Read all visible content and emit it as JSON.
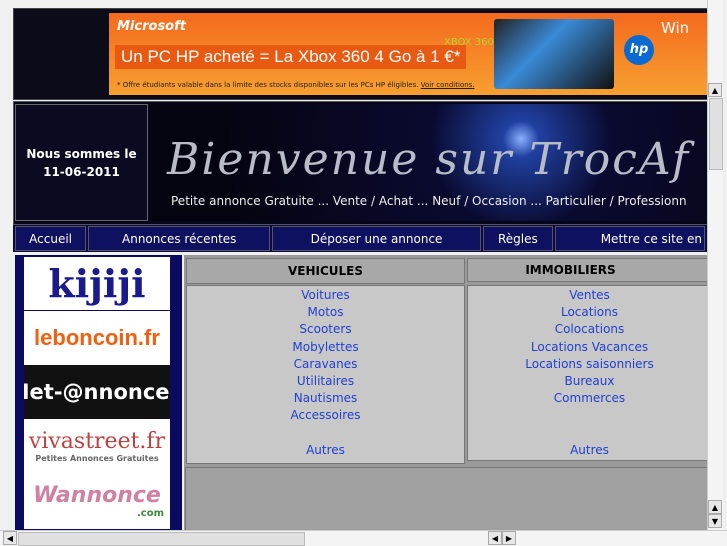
{
  "ad": {
    "brand": "Microsoft",
    "headline": "Un PC HP acheté = La Xbox 360 4 Go à 1 €*",
    "fine_print": "* Offre étudiants valable dans la limite des stocks disponibles sur les PCs HP éligibles.",
    "link": "Voir conditions.",
    "xbox": "XBOX 360",
    "hp": "hp",
    "windows": "Win"
  },
  "header": {
    "date_label": "Nous sommes le",
    "date": "11-06-2011",
    "welcome": "Bienvenue sur TrocAf",
    "tagline": "Petite annonce Gratuite ... Vente / Achat ... Neuf / Occasion ... Particulier / Professionn"
  },
  "nav": [
    {
      "label": "Accueil"
    },
    {
      "label": "Annonces récentes"
    },
    {
      "label": "Déposer une annonce"
    },
    {
      "label": "Règles"
    },
    {
      "label": "Mettre ce site en"
    }
  ],
  "logos": [
    {
      "label": "kijiji"
    },
    {
      "label": "leboncoin.fr"
    },
    {
      "label": "Net-@nnonces"
    },
    {
      "label": "vivastreet.fr",
      "sub": "Petites Annonces Gratuites"
    },
    {
      "label": "Wannonce",
      "sub": ".com"
    }
  ],
  "categories": [
    {
      "title": "VEHICULES",
      "items": [
        "Voitures",
        "Motos",
        "Scooters",
        "Mobylettes",
        "Caravanes",
        "Utilitaires",
        "Nautismes",
        "Accessoires"
      ],
      "other": "Autres"
    },
    {
      "title": "IMMOBILIERS",
      "items": [
        "Ventes",
        "Locations",
        "Colocations",
        "Locations Vacances",
        "Locations saisonniers",
        "Bureaux",
        "Commerces"
      ],
      "other": "Autres"
    }
  ]
}
